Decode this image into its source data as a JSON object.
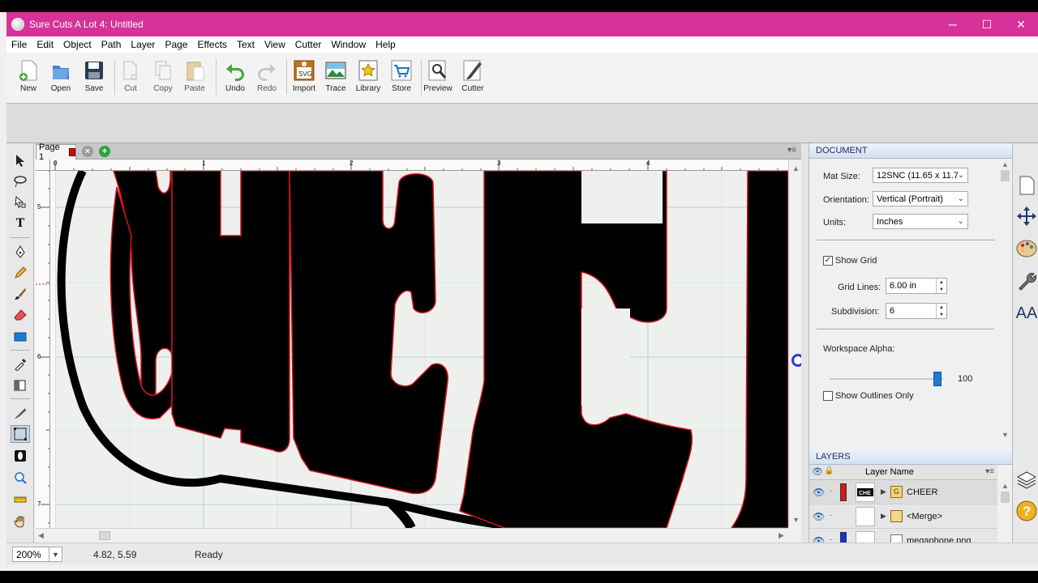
{
  "window": {
    "title": "Sure Cuts A Lot 4: Untitled",
    "minimize": "─",
    "maximize": "☐",
    "close": "✕"
  },
  "menu": [
    "File",
    "Edit",
    "Object",
    "Path",
    "Layer",
    "Page",
    "Effects",
    "Text",
    "View",
    "Cutter",
    "Window",
    "Help"
  ],
  "toolbar": {
    "new": "New",
    "open": "Open",
    "save": "Save",
    "cut": "Cut",
    "copy": "Copy",
    "paste": "Paste",
    "undo": "Undo",
    "redo": "Redo",
    "import": "Import",
    "trace": "Trace",
    "library": "Library",
    "store": "Store",
    "preview": "Preview",
    "cutter": "Cutter"
  },
  "page_tabs": {
    "current": "Page 1",
    "tab_color": "#dd0000"
  },
  "ruler": {
    "top_marks": [
      "0",
      "1",
      "2",
      "3",
      "4"
    ],
    "left_marks": [
      "5",
      "6",
      "7"
    ]
  },
  "canvas": {
    "text": "CHEER",
    "fill": "#000000",
    "outline": "#d4141e"
  },
  "status": {
    "zoom": "200%",
    "coords": "4.82, 5.59",
    "state": "Ready"
  },
  "document": {
    "header": "DOCUMENT",
    "mat_size_label": "Mat Size:",
    "mat_size_value": "12SNC (11.65 x 11.7",
    "orientation_label": "Orientation:",
    "orientation_value": "Vertical (Portrait)",
    "units_label": "Units:",
    "units_value": "Inches",
    "show_grid_label": "Show Grid",
    "show_grid_checked": true,
    "grid_lines_label": "Grid Lines:",
    "grid_lines_value": "6.00 in",
    "subdivision_label": "Subdivision:",
    "subdivision_value": "6",
    "workspace_alpha_label": "Workspace Alpha:",
    "workspace_alpha_value": "100",
    "show_outlines_label": "Show Outlines Only",
    "show_outlines_checked": false
  },
  "layers": {
    "header": "LAYERS",
    "column": "Layer Name",
    "items": [
      {
        "name": "CHEER",
        "color": "#d11a1a",
        "type": "G"
      },
      {
        "name": "<Merge>",
        "color": "",
        "type": ""
      },
      {
        "name": "megaphone.png",
        "color": "#1a2fd1",
        "type": ""
      }
    ]
  },
  "side_icons": [
    "page-icon",
    "move-icon",
    "palette-icon",
    "wrench-icon",
    "text-size-icon",
    "layers-icon",
    "help-icon"
  ]
}
